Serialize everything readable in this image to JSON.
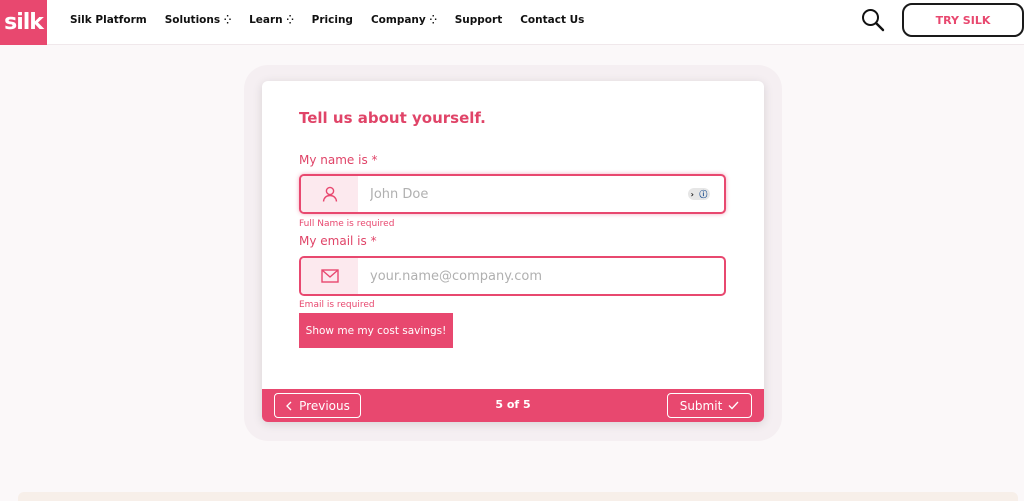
{
  "brand": {
    "logo_text": "silk",
    "accent": "#e8486f"
  },
  "nav": {
    "items": [
      {
        "label": "Silk Platform",
        "has_dropdown": false
      },
      {
        "label": "Solutions",
        "has_dropdown": true
      },
      {
        "label": "Learn",
        "has_dropdown": true
      },
      {
        "label": "Pricing",
        "has_dropdown": false
      },
      {
        "label": "Company",
        "has_dropdown": true
      },
      {
        "label": "Support",
        "has_dropdown": false
      },
      {
        "label": "Contact Us",
        "has_dropdown": false
      }
    ],
    "dropdown_glyph": "⁛",
    "search_icon": "search-icon",
    "cta_label": "TRY SILK"
  },
  "form": {
    "title": "Tell us about yourself.",
    "name_field": {
      "label": "My name is *",
      "placeholder": "John Doe",
      "value": "",
      "icon": "user-icon",
      "error": "Full Name is required"
    },
    "email_field": {
      "label": "My email is *",
      "placeholder": "your.name@company.com",
      "value": "",
      "icon": "envelope-icon",
      "error": "Email is required"
    },
    "submit_cta": "Show me my cost savings!"
  },
  "footer": {
    "previous_label": "Previous",
    "step_text": "5 of 5",
    "submit_label": "Submit"
  }
}
